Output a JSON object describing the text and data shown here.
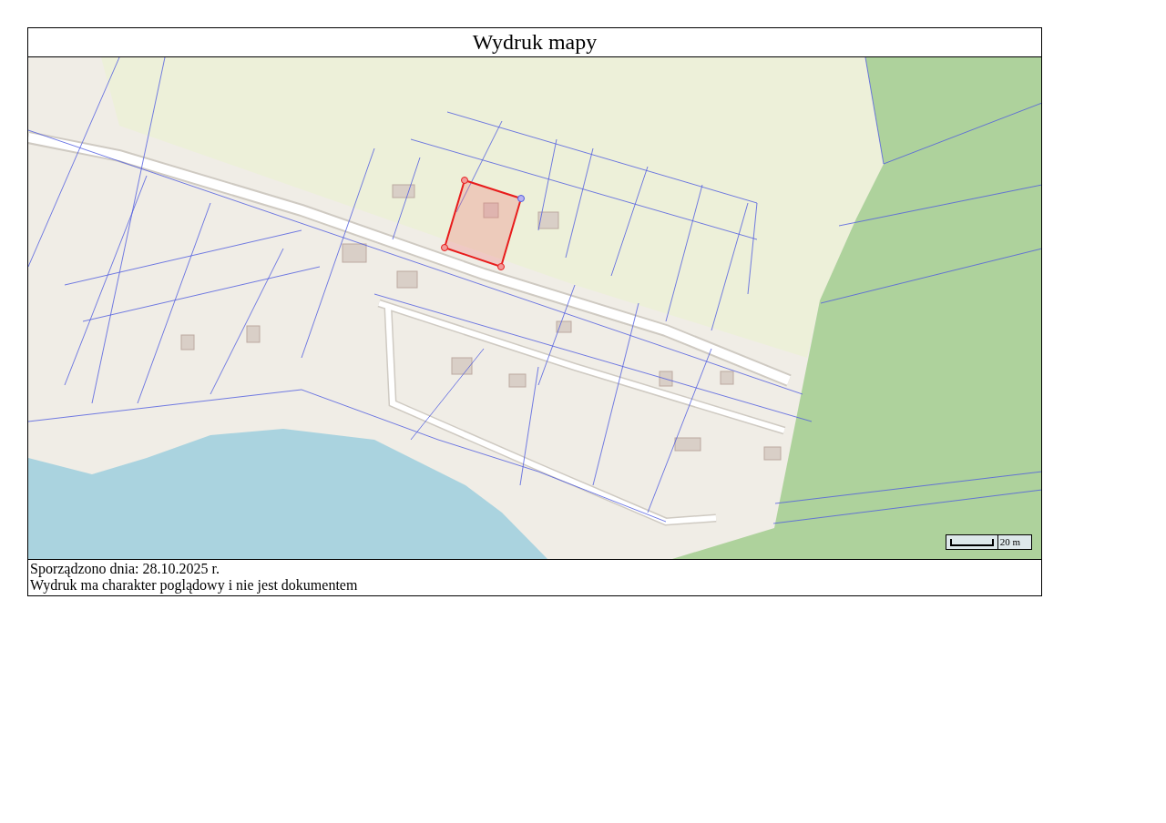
{
  "title": "Wydruk mapy",
  "map": {
    "scale_label": "20 m"
  },
  "footer": {
    "created": "Sporządzono dnia: 28.10.2025 r.",
    "disclaimer": "Wydruk ma charakter poglądowy i nie jest dokumentem"
  }
}
